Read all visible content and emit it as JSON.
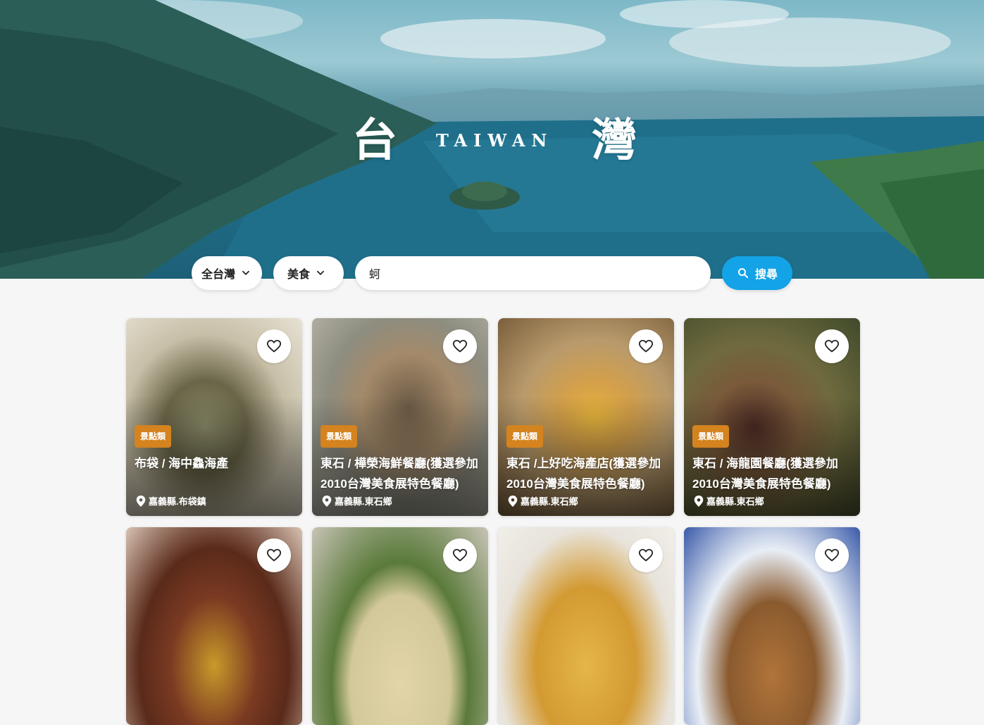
{
  "hero": {
    "title_char_1": "台",
    "title_en": "TAIWAN",
    "title_char_2": "灣"
  },
  "search": {
    "region_label": "全台灣",
    "category_label": "美食",
    "keyword_value": "蚵",
    "button_label": "搜尋"
  },
  "colors": {
    "accent": "#13a3e6",
    "badge": "#d4831f"
  },
  "cards": [
    {
      "badge": "景點類",
      "title": "布袋 / 海中鱻海產",
      "location": "嘉義縣.布袋鎮"
    },
    {
      "badge": "景點類",
      "title": "東石 / 樺榮海鮮餐廳(獲選參加2010台灣美食展特色餐廳)",
      "location": "嘉義縣.東石鄉"
    },
    {
      "badge": "景點類",
      "title": "東石 /上好吃海產店(獲選參加2010台灣美食展特色餐廳)",
      "location": "嘉義縣.東石鄉"
    },
    {
      "badge": "景點類",
      "title": "東石 / 海龍園餐廳(獲選參加2010台灣美食展特色餐廳)",
      "location": "嘉義縣.東石鄉"
    }
  ]
}
